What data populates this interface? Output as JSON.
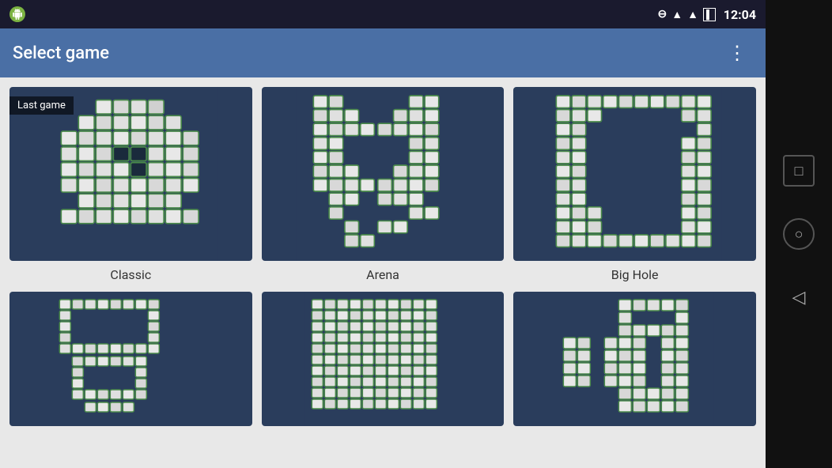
{
  "statusBar": {
    "time": "12:04",
    "icons": [
      "do-not-disturb",
      "wifi",
      "signal",
      "battery"
    ]
  },
  "appBar": {
    "title": "Select game",
    "moreIcon": "⋮"
  },
  "games": [
    {
      "id": "classic",
      "label": "Classic",
      "badge": "Last game",
      "hasBadge": true,
      "row": "top"
    },
    {
      "id": "arena",
      "label": "Arena",
      "hasBadge": false,
      "row": "top"
    },
    {
      "id": "big-hole",
      "label": "Big Hole",
      "hasBadge": false,
      "row": "top"
    },
    {
      "id": "spiral",
      "label": "",
      "hasBadge": false,
      "row": "bottom"
    },
    {
      "id": "full",
      "label": "",
      "hasBadge": false,
      "row": "bottom"
    },
    {
      "id": "cross",
      "label": "",
      "hasBadge": false,
      "row": "bottom"
    }
  ],
  "navBar": {
    "squareLabel": "□",
    "circleLabel": "○",
    "triangleLabel": "◁"
  }
}
